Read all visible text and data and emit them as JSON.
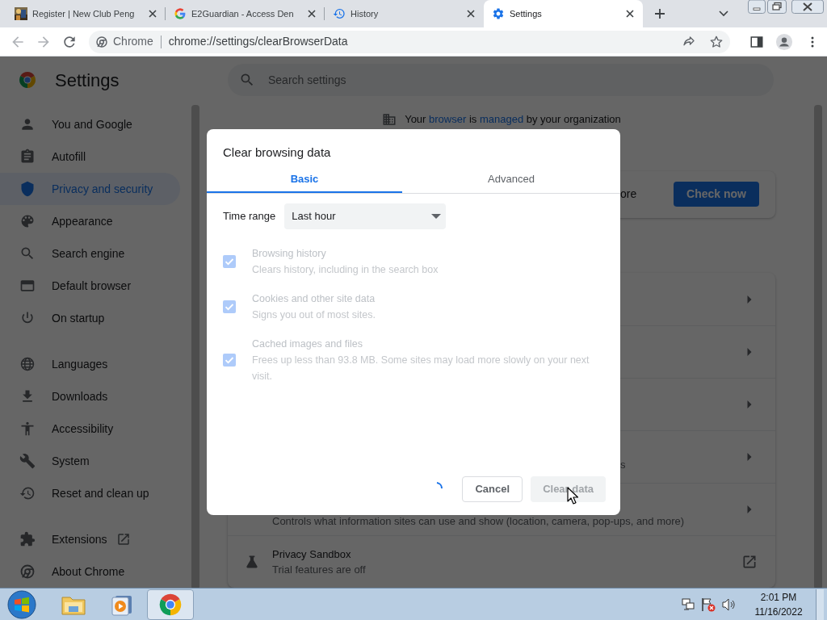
{
  "browser": {
    "tabs": [
      {
        "title": "Register | New Club Peng",
        "kind": "picture",
        "selected": false
      },
      {
        "title": "E2Guardian - Access Den",
        "kind": "google",
        "selected": false
      },
      {
        "title": "History",
        "kind": "history",
        "selected": false
      },
      {
        "title": "Settings",
        "kind": "gear",
        "selected": true
      }
    ],
    "omnibox": {
      "chip": "Chrome",
      "url": "chrome://settings/clearBrowserData"
    }
  },
  "settings": {
    "title": "Settings",
    "search_placeholder": "Search settings",
    "nav_groups": [
      [
        {
          "label": "You and Google",
          "kind": "person",
          "selected": false
        },
        {
          "label": "Autofill",
          "kind": "clipboard",
          "selected": false
        },
        {
          "label": "Privacy and security",
          "kind": "shield",
          "selected": true
        },
        {
          "label": "Appearance",
          "kind": "palette",
          "selected": false
        },
        {
          "label": "Search engine",
          "kind": "search",
          "selected": false
        },
        {
          "label": "Default browser",
          "kind": "browser",
          "selected": false
        },
        {
          "label": "On startup",
          "kind": "power",
          "selected": false
        }
      ],
      [
        {
          "label": "Languages",
          "kind": "globe",
          "selected": false
        },
        {
          "label": "Downloads",
          "kind": "download",
          "selected": false
        },
        {
          "label": "Accessibility",
          "kind": "accessibility",
          "selected": false
        },
        {
          "label": "System",
          "kind": "wrench",
          "selected": false
        },
        {
          "label": "Reset and clean up",
          "kind": "restore",
          "selected": false
        }
      ],
      [
        {
          "label": "Extensions",
          "kind": "puzzle",
          "selected": false,
          "external": true
        },
        {
          "label": "About Chrome",
          "kind": "chrome",
          "selected": false
        }
      ]
    ],
    "managed_notice": [
      {
        "text": "Your ",
        "link": false
      },
      {
        "text": "browser",
        "link": true
      },
      {
        "text": " is ",
        "link": false
      },
      {
        "text": "managed",
        "link": true
      },
      {
        "text": " by your organization",
        "link": false
      }
    ],
    "safety_check": {
      "visible_text": "ore",
      "button": "Check now"
    },
    "rows": [
      {
        "kind": "arrow"
      },
      {
        "kind": "arrow"
      },
      {
        "kind": "arrow"
      },
      {
        "kind": "arrow",
        "visible_text": "s"
      },
      {
        "kind": "arrow",
        "subtitle": "Controls what information sites can use and show (location, camera, pop-ups, and more)"
      },
      {
        "kind": "external",
        "title": "Privacy Sandbox",
        "subtitle": "Trial features are off"
      }
    ]
  },
  "dialog": {
    "title": "Clear browsing data",
    "tabs": [
      {
        "label": "Basic",
        "selected": true
      },
      {
        "label": "Advanced",
        "selected": false
      }
    ],
    "time_range": {
      "label": "Time range",
      "value": "Last hour"
    },
    "options": [
      {
        "title": "Browsing history",
        "description": "Clears history, including in the search box",
        "checked": true,
        "disabled": true
      },
      {
        "title": "Cookies and other site data",
        "description": "Signs you out of most sites.",
        "checked": true,
        "disabled": true
      },
      {
        "title": "Cached images and files",
        "description": "Frees up less than 93.8 MB. Some sites may load more slowly on your next visit.",
        "checked": true,
        "disabled": true
      }
    ],
    "loading": true,
    "buttons": [
      {
        "label": "Cancel",
        "disabled": false
      },
      {
        "label": "Clear data",
        "disabled": true
      }
    ]
  },
  "taskbar": {
    "apps": [
      {
        "kind": "folder",
        "selected": false
      },
      {
        "kind": "media",
        "selected": false
      },
      {
        "kind": "chrome",
        "selected": true
      }
    ],
    "time": "2:01 PM",
    "date": "11/16/2022"
  }
}
